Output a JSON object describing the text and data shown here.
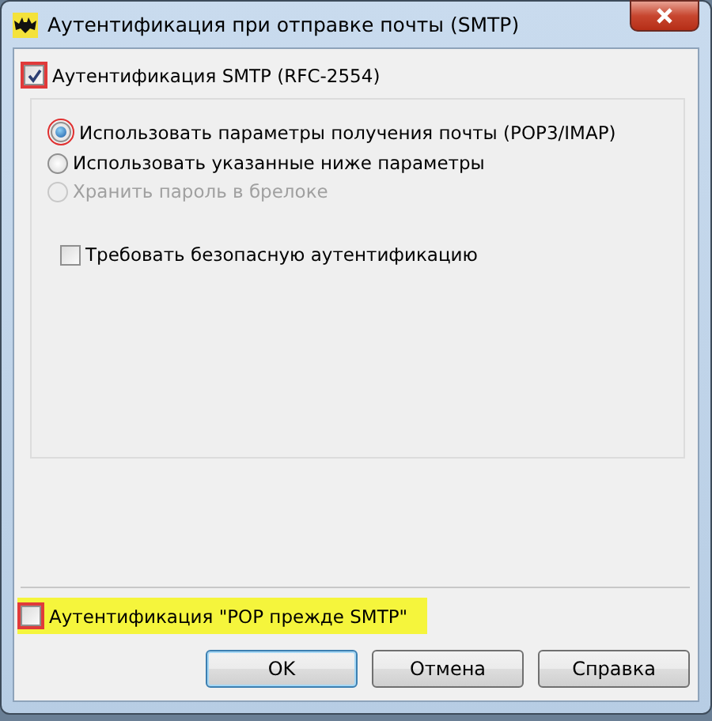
{
  "window": {
    "title": "Аутентификация при отправке почты (SMTP)"
  },
  "smtp_auth": {
    "label": "Аутентификация SMTP (RFC-2554)",
    "checked": true,
    "marked": true
  },
  "options": [
    {
      "label": "Использовать параметры получения почты (POP3/IMAP)",
      "selected": true,
      "disabled": false,
      "marked": true
    },
    {
      "label": "Использовать указанные ниже параметры",
      "selected": false,
      "disabled": false,
      "marked": false
    },
    {
      "label": "Хранить пароль в брелоке",
      "selected": false,
      "disabled": true,
      "marked": false
    }
  ],
  "secure_auth": {
    "label": "Требовать безопасную аутентификацию",
    "checked": false,
    "marked": false
  },
  "pop_before_smtp": {
    "label": "Аутентификация \"POP прежде SMTP\"",
    "checked": false,
    "marked": true,
    "highlighted": true
  },
  "buttons": [
    {
      "label": "OK",
      "default": true
    },
    {
      "label": "Отмена",
      "default": false
    },
    {
      "label": "Справка",
      "default": false
    }
  ]
}
